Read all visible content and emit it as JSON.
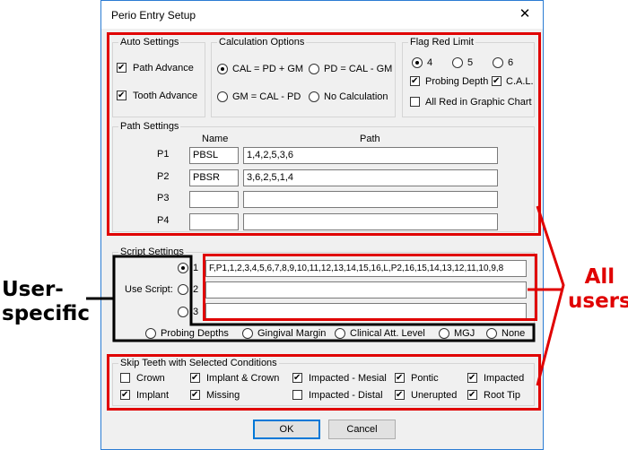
{
  "window": {
    "title": "Perio Entry Setup",
    "close_glyph": "✕"
  },
  "auto_settings": {
    "title": "Auto Settings",
    "path_advance": "Path Advance",
    "tooth_advance": "Tooth Advance"
  },
  "calc_options": {
    "title": "Calculation Options",
    "opt1": "CAL = PD + GM",
    "opt2": "PD = CAL - GM",
    "opt3": "GM = CAL - PD",
    "opt4": "No Calculation"
  },
  "flag_red": {
    "title": "Flag Red Limit",
    "v4": "4",
    "v5": "5",
    "v6": "6",
    "probing_depth": "Probing Depth",
    "cal": "C.A.L.",
    "all_red": "All Red in Graphic Chart"
  },
  "path_settings": {
    "title": "Path Settings",
    "col_name": "Name",
    "col_path": "Path",
    "rows": [
      {
        "label": "P1",
        "name": "PBSL",
        "path": "1,4,2,5,3,6"
      },
      {
        "label": "P2",
        "name": "PBSR",
        "path": "3,6,2,5,1,4"
      },
      {
        "label": "P3",
        "name": "",
        "path": ""
      },
      {
        "label": "P4",
        "name": "",
        "path": ""
      }
    ]
  },
  "script_settings": {
    "title": "Script Settings",
    "use_script": "Use Script:",
    "s1": "1",
    "s2": "2",
    "s3": "3",
    "script1": "F,P1,1,2,3,4,5,6,7,8,9,10,11,12,13,14,15,16,L,P2,16,15,14,13,12,11,10,9,8",
    "script2": "",
    "script3": "",
    "probing_depths": "Probing Depths",
    "gingival_margin": "Gingival Margin",
    "clinical_att": "Clinical Att. Level",
    "mgj": "MGJ",
    "none": "None"
  },
  "skip_teeth": {
    "title": "Skip Teeth with Selected Conditions",
    "crown": "Crown",
    "implant_crown": "Implant & Crown",
    "impacted_mesial": "Impacted - Mesial",
    "pontic": "Pontic",
    "impacted": "Impacted",
    "implant": "Implant",
    "missing": "Missing",
    "impacted_distal": "Impacted - Distal",
    "unerupted": "Unerupted",
    "root_tip": "Root Tip"
  },
  "buttons": {
    "ok": "OK",
    "cancel": "Cancel"
  },
  "annotations": {
    "user_specific_line1": "User-",
    "user_specific_line2": "specific",
    "all_users_line1": "All",
    "all_users_line2": "users"
  },
  "colors": {
    "annotation_red": "#e00000",
    "annotation_black": "#000000",
    "window_border": "#2b7cd3"
  }
}
